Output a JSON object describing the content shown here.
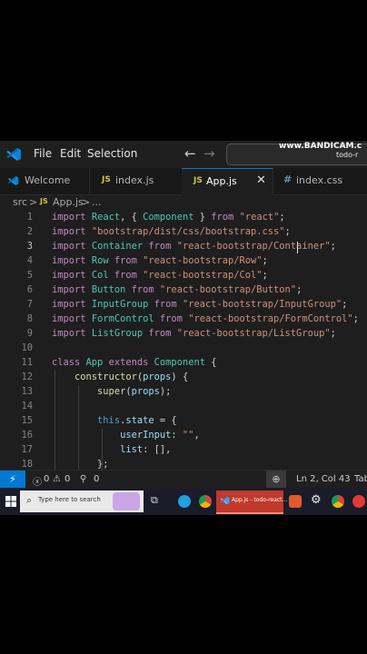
{
  "watermark": {
    "brand": "www.BANDICAM.c",
    "sub": "todo-r"
  },
  "titlebar": {
    "menus": [
      "File",
      "Edit",
      "Selection"
    ]
  },
  "tabs": [
    {
      "label": "Welcome",
      "icon": "vscode-icon"
    },
    {
      "label": "index.js",
      "icon": "JS"
    },
    {
      "label": "App.js",
      "icon": "JS",
      "active": true
    },
    {
      "label": "index.css",
      "icon": "#"
    }
  ],
  "breadcrumb": {
    "folder": "src",
    "sep": ">",
    "icon": "JS",
    "file": "App.js",
    "more": "..."
  },
  "editor": {
    "current_line": 3,
    "lines": [
      {
        "n": "1",
        "code": "import React, { Component } from \"react\";"
      },
      {
        "n": "2",
        "code": "import \"bootstrap/dist/css/bootstrap.css\";"
      },
      {
        "n": "3",
        "code": "import Container from \"react-bootstrap/Container\";"
      },
      {
        "n": "4",
        "code": "import Row from \"react-bootstrap/Row\";"
      },
      {
        "n": "5",
        "code": "import Col from \"react-bootstrap/Col\";"
      },
      {
        "n": "6",
        "code": "import Button from \"react-bootstrap/Button\";"
      },
      {
        "n": "7",
        "code": "import InputGroup from \"react-bootstrap/InputGroup\";"
      },
      {
        "n": "8",
        "code": "import FormControl from \"react-bootstrap/FormControl\";"
      },
      {
        "n": "9",
        "code": "import ListGroup from \"react-bootstrap/ListGroup\";"
      },
      {
        "n": "10",
        "code": ""
      },
      {
        "n": "11",
        "code": "class App extends Component {"
      },
      {
        "n": "12",
        "code": "    constructor(props) {"
      },
      {
        "n": "13",
        "code": "        super(props);"
      },
      {
        "n": "14",
        "code": ""
      },
      {
        "n": "15",
        "code": "        this.state = {"
      },
      {
        "n": "16",
        "code": "            userInput: \"\","
      },
      {
        "n": "17",
        "code": "            list: [],"
      },
      {
        "n": "18",
        "code": "        };"
      }
    ]
  },
  "statusbar": {
    "remote": "⚡",
    "errors": "0",
    "warnings": "0",
    "ports": "0",
    "position": "Ln 2, Col 43",
    "tab": "Tab"
  },
  "taskbar": {
    "search_placeholder": "Type here to search",
    "app_label": "App.js - todo-react..."
  },
  "colors": {
    "accent": "#0078d4",
    "keyword": "#c586c0",
    "string": "#ce9178",
    "class": "#4ec9b0",
    "variable": "#9cdcfe",
    "function": "#dcdcaa",
    "this": "#569cd6"
  }
}
